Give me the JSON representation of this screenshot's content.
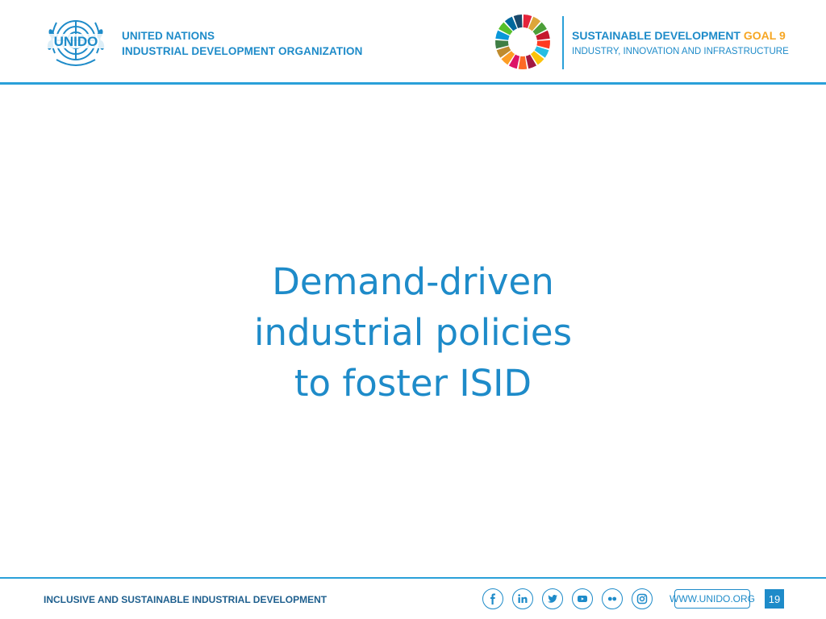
{
  "header": {
    "unido_logo_text": "UNIDO",
    "org_line1": "UNITED NATIONS",
    "org_line2": "INDUSTRIAL DEVELOPMENT ORGANIZATION",
    "sdg_title": "SUSTAINABLE DEVELOPMENT",
    "sdg_goal": "GOAL 9",
    "sdg_subtitle": "INDUSTRY, INNOVATION AND INFRASTRUCTURE",
    "sdg_colors": [
      "#e5243b",
      "#dda63a",
      "#4c9f38",
      "#c5192d",
      "#ff3a21",
      "#26bde2",
      "#fcc30b",
      "#a21942",
      "#fd6925",
      "#dd1367",
      "#fd9d24",
      "#bf8b2e",
      "#3f7e44",
      "#0a97d9",
      "#56c02b",
      "#00689d",
      "#19486a"
    ]
  },
  "slide": {
    "title_line1": "Demand-driven",
    "title_line2": "industrial policies",
    "title_line3": "to foster ISID"
  },
  "footer": {
    "tagline": "INCLUSIVE AND SUSTAINABLE INDUSTRIAL DEVELOPMENT",
    "social_icons": [
      "facebook-icon",
      "linkedin-icon",
      "twitter-icon",
      "youtube-icon",
      "flickr-icon",
      "instagram-icon"
    ],
    "website": "WWW.UNIDO.ORG",
    "page_number": "19"
  },
  "colors": {
    "brand_blue": "#1e8bc9",
    "rule_blue": "#2aa0d9",
    "goal_orange": "#f6a623"
  }
}
